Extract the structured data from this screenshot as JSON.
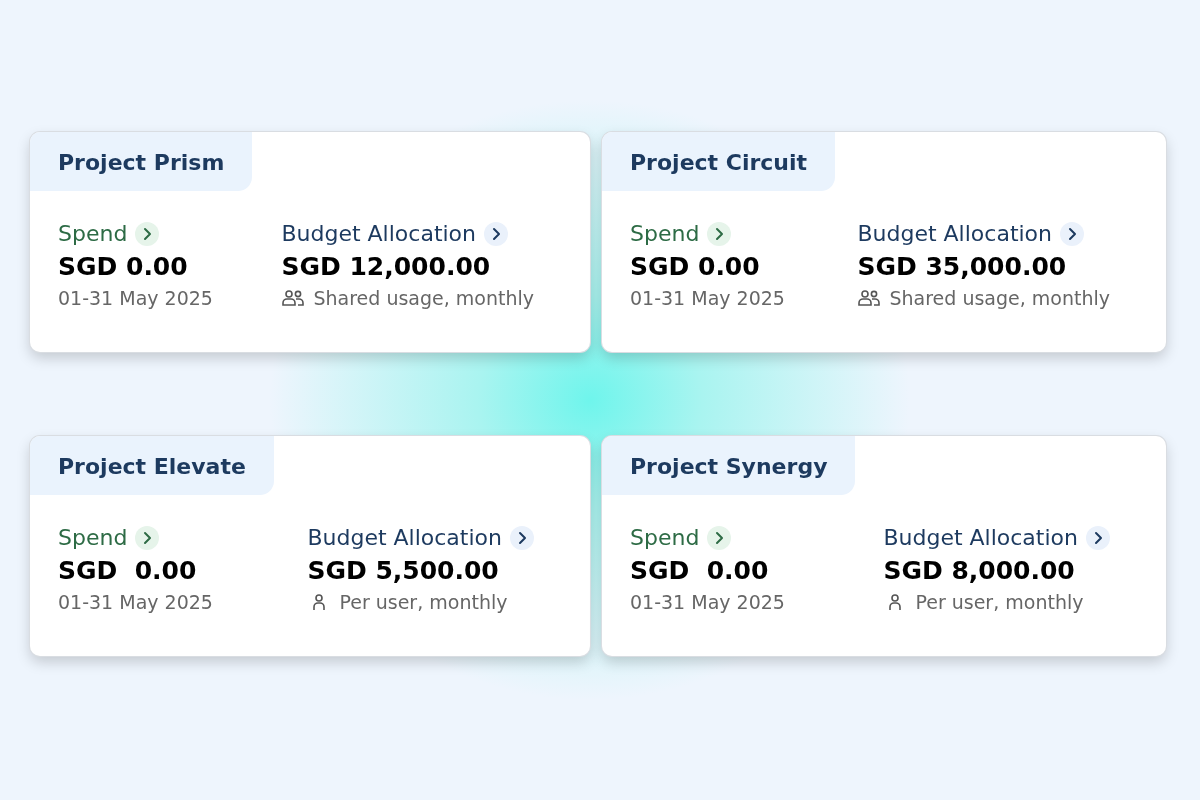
{
  "cards": [
    {
      "title": "Project Prism",
      "spend": {
        "label": "Spend",
        "amount": "SGD 0.00",
        "period": "01-31 May 2025"
      },
      "budget": {
        "kind": "shared",
        "label": "Budget Allocation",
        "amount": "SGD 12,000.00",
        "usage": "Shared usage, monthly"
      }
    },
    {
      "title": "Project Circuit",
      "spend": {
        "label": "Spend",
        "amount": "SGD 0.00",
        "period": "01-31 May 2025"
      },
      "budget": {
        "kind": "shared",
        "label": "Budget Allocation",
        "amount": "SGD 35,000.00",
        "usage": "Shared usage, monthly"
      }
    },
    {
      "title": "Project Elevate",
      "spend": {
        "label": "Spend",
        "amount": "SGD  0.00",
        "period": "01-31 May 2025"
      },
      "budget": {
        "kind": "per_user",
        "label": "Budget Allocation",
        "amount": "SGD 5,500.00",
        "usage": "Per user, monthly"
      }
    },
    {
      "title": "Project Synergy",
      "spend": {
        "label": "Spend",
        "amount": "SGD  0.00",
        "period": "01-31 May 2025"
      },
      "budget": {
        "kind": "per_user",
        "label": "Budget Allocation",
        "amount": "SGD 8,000.00",
        "usage": "Per user, monthly"
      }
    }
  ]
}
